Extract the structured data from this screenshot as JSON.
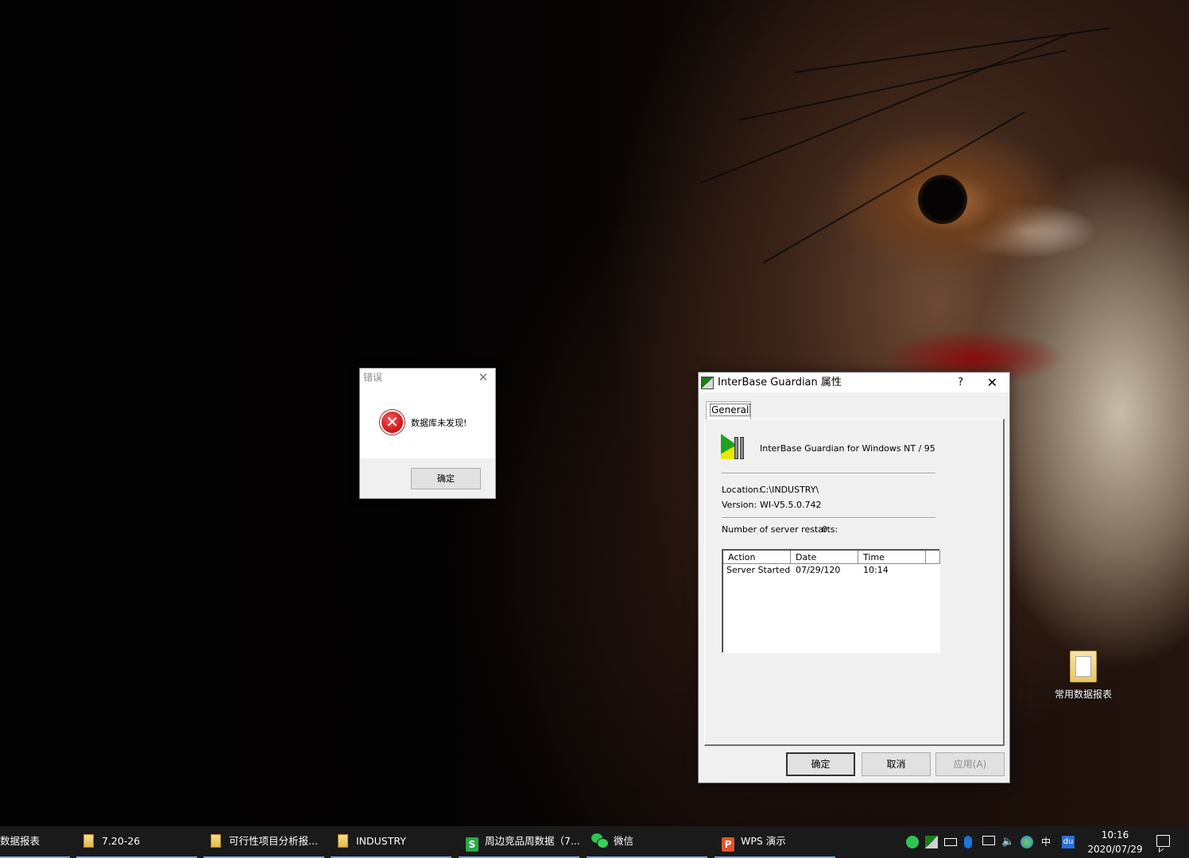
{
  "desktop": {
    "icons": [
      {
        "label": "常用数据报表",
        "icon": "folder-icon"
      }
    ]
  },
  "error_dialog": {
    "title": "错误",
    "message": "数据库未发现!",
    "ok_label": "确定",
    "icon": "error-icon",
    "close_icon": "close-icon"
  },
  "ib_dialog": {
    "title": "InterBase Guardian 属性",
    "help_label": "?",
    "close_icon": "close-icon",
    "tab_label": "General",
    "product_name": "InterBase Guardian for Windows NT / 95",
    "location_label": "Location:",
    "location_value": "C:\\INDUSTRY\\",
    "version_label": "Version:",
    "version_value": "WI-V5.5.0.742",
    "restarts_label": "Number of server restarts:",
    "restarts_value": "0",
    "columns": [
      "Action",
      "Date",
      "Time"
    ],
    "rows": [
      {
        "action": "Server Started",
        "date": "07/29/120",
        "time": "10:14"
      }
    ],
    "buttons": {
      "ok": "确定",
      "cancel": "取消",
      "apply": "应用(A)"
    }
  },
  "taskbar": {
    "items": [
      {
        "label": "数据报表",
        "icon": "excel-icon",
        "active": true
      },
      {
        "label": "7.20-26",
        "icon": "folder-icon",
        "active": true
      },
      {
        "label": "可行性项目分析报...",
        "icon": "folder-icon",
        "active": true
      },
      {
        "label": "INDUSTRY",
        "icon": "folder-icon",
        "active": true
      },
      {
        "label": "周边竞品周数据（7...",
        "icon": "wps-spreadsheet-icon",
        "active": true
      },
      {
        "label": "微信",
        "icon": "wechat-icon",
        "active": true
      },
      {
        "label": "WPS 演示",
        "icon": "wps-presentation-icon",
        "active": true
      }
    ],
    "tray": {
      "ime_label": "中",
      "baidu_label": "du",
      "time": "10:16",
      "date": "2020/07/29"
    },
    "accent_color": "#7aa7d8"
  }
}
